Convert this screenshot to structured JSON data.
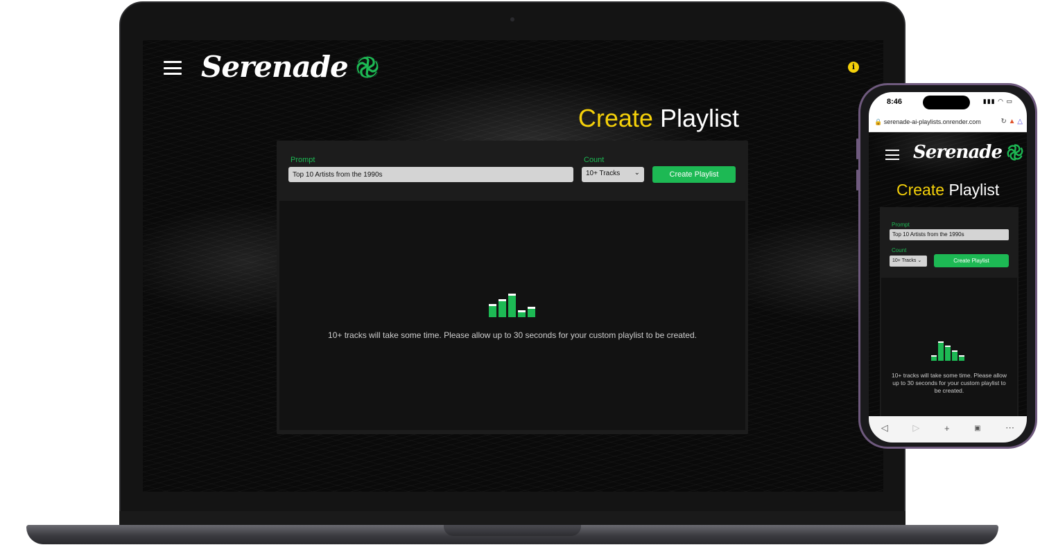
{
  "app": {
    "name": "Serenade",
    "heading_highlight": "Create",
    "heading_rest": "Playlist",
    "info_icon": "i"
  },
  "form": {
    "prompt_label": "Prompt",
    "prompt_value": "Top 10 Artists from the 1990s",
    "count_label": "Count",
    "count_value": "10+ Tracks",
    "submit_label": "Create Playlist"
  },
  "loading": {
    "message": "10+ tracks will take some time. Please allow up to 30 seconds for your custom playlist to be created.",
    "bar_levels_laptop": [
      0.55,
      0.75,
      1.0,
      0.3,
      0.45
    ],
    "bar_levels_phone": [
      0.3,
      1.0,
      0.8,
      0.55,
      0.3
    ]
  },
  "phone_status": {
    "time": "8:46",
    "url": "serenade-ai-playlists.onrender.com"
  },
  "colors": {
    "accent_green": "#1db954",
    "accent_yellow": "#f5d10a",
    "background": "#0a0a0a",
    "panel": "#1c1c1c"
  },
  "icons": [
    "hamburger-menu-icon",
    "openai-logo-icon",
    "info-icon",
    "back-icon",
    "forward-icon",
    "plus-icon",
    "tabs-icon",
    "more-icon"
  ]
}
